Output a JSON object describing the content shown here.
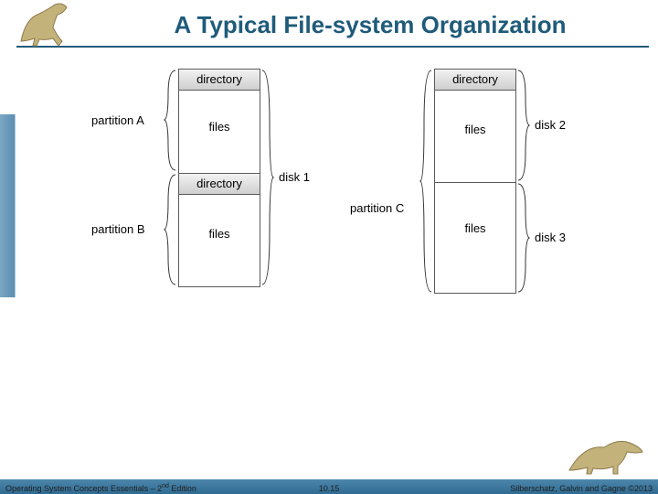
{
  "slide": {
    "title": "A Typical File-system Organization"
  },
  "diagram": {
    "columns": [
      {
        "segments": [
          {
            "header": "directory",
            "body": "files"
          },
          {
            "header": "directory",
            "body": "files"
          }
        ]
      },
      {
        "segments": [
          {
            "header": "directory",
            "body": "files"
          },
          {
            "header": "",
            "body": "files"
          }
        ]
      }
    ],
    "labels": {
      "partition_a": "partition A",
      "partition_b": "partition B",
      "partition_c": "partition C",
      "disk_1": "disk 1",
      "disk_2": "disk 2",
      "disk_3": "disk 3"
    }
  },
  "footer": {
    "left_prefix": "Operating System Concepts Essentials – 2",
    "left_suffix": " Edition",
    "left_sup": "nd",
    "center": "10.15",
    "right": "Silberschatz, Galvin and Gagne ©2013"
  },
  "icons": {
    "dino_tl": "dinosaur-icon",
    "dino_br": "dinosaur-icon"
  }
}
